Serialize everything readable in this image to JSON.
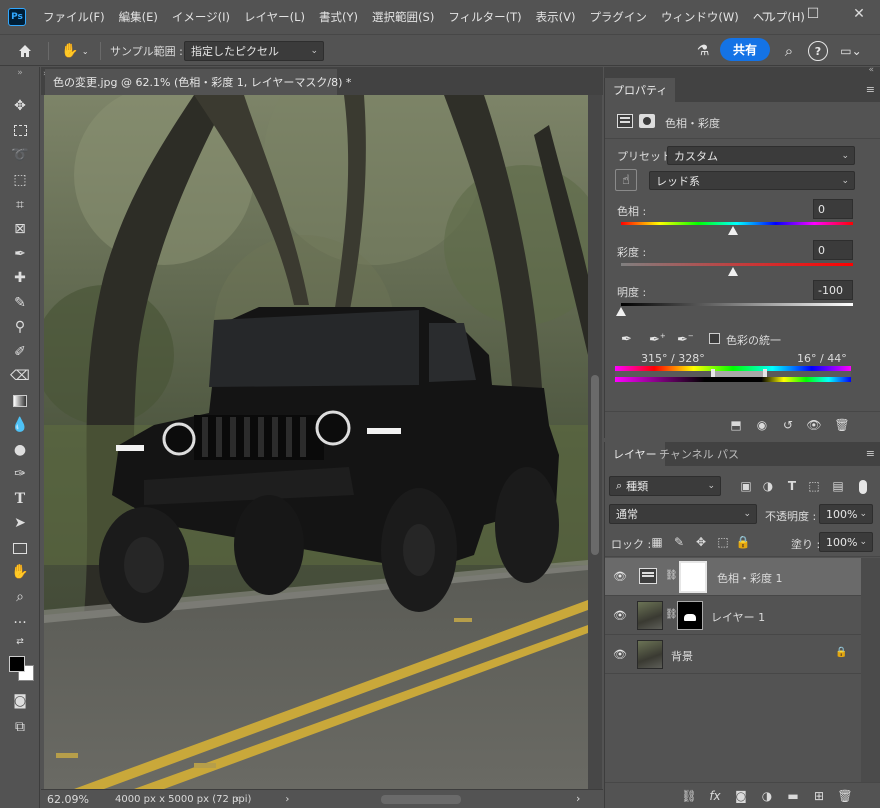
{
  "app": {
    "logo": "Ps"
  },
  "menu": [
    "ファイル(F)",
    "編集(E)",
    "イメージ(I)",
    "レイヤー(L)",
    "書式(Y)",
    "選択範囲(S)",
    "フィルター(T)",
    "表示(V)",
    "プラグイン",
    "ウィンドウ(W)",
    "ヘルプ(H)"
  ],
  "options": {
    "sample_label": "サンプル範囲 :",
    "sample_value": "指定したピクセル",
    "share": "共有"
  },
  "document": {
    "tab_title": "色の変更.jpg @ 62.1% (色相・彩度 1, レイヤーマスク/8) *",
    "zoom": "62.09%",
    "info": "4000 px x 5000 px (72 ppi)"
  },
  "properties": {
    "tab": "プロパティ",
    "header": "色相・彩度",
    "preset_label": "プリセット :",
    "preset_value": "カスタム",
    "channel_value": "レッド系",
    "hue_label": "色相 :",
    "hue_value": "0",
    "saturation_label": "彩度 :",
    "saturation_value": "0",
    "lightness_label": "明度 :",
    "lightness_value": "-100",
    "colorize_label": "色彩の統一",
    "range_left": "315° / 328°",
    "range_right": "16° / 44°"
  },
  "layers": {
    "tabs": [
      "レイヤー",
      "チャンネル",
      "パス"
    ],
    "filter_value": "種類",
    "blend_mode": "通常",
    "opacity_label": "不透明度 :",
    "opacity_value": "100%",
    "lock_label": "ロック :",
    "fill_label": "塗り :",
    "fill_value": "100%",
    "items": [
      {
        "name": "色相・彩度 1",
        "selected": true
      },
      {
        "name": "レイヤー 1",
        "selected": false
      },
      {
        "name": "背景",
        "selected": false
      }
    ]
  }
}
